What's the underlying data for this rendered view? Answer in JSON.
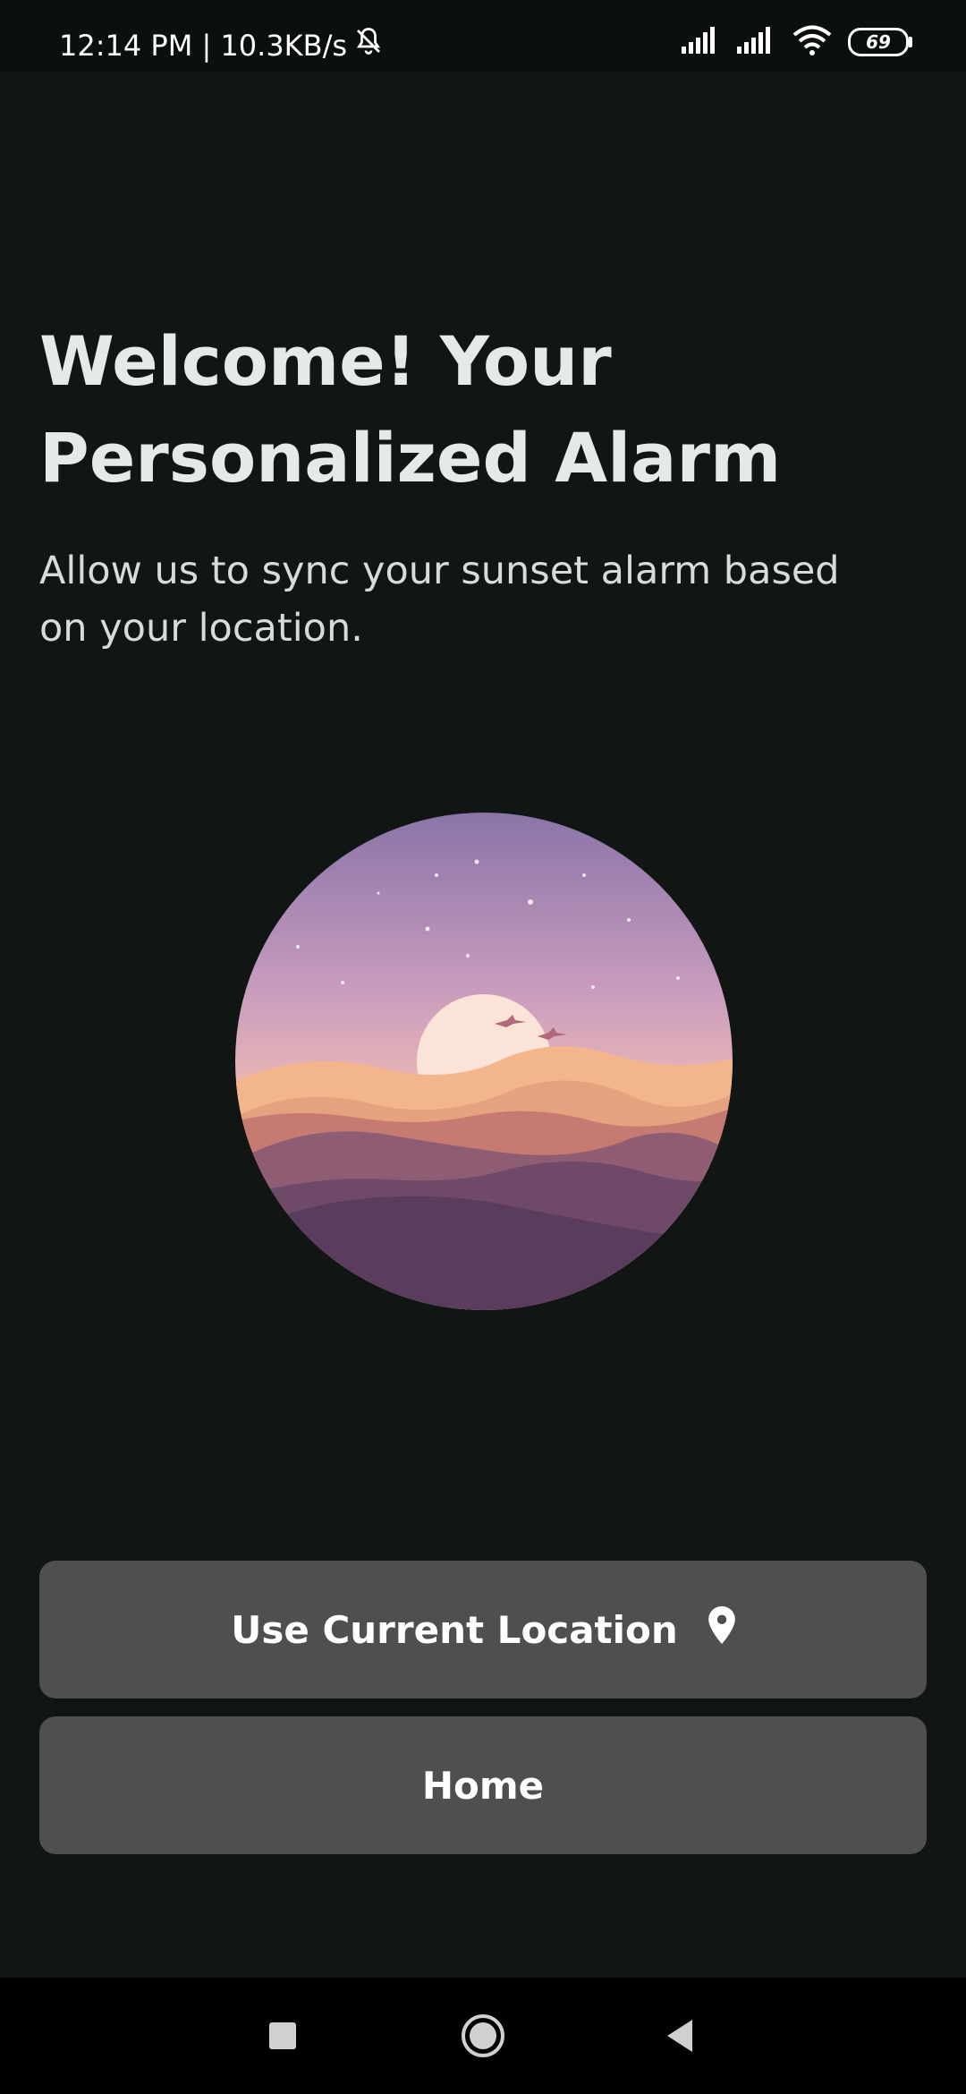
{
  "status_bar": {
    "time_speed": "12:14 PM | 10.3KB/s",
    "battery": "69",
    "icons": [
      "bell-off-icon",
      "signal-icon",
      "signal-icon",
      "wifi-icon",
      "battery-icon"
    ]
  },
  "main": {
    "title_line1": "Welcome! Your",
    "title_line2": "Personalized Alarm",
    "subtitle": "Allow us to sync your sunset alarm based on your location.",
    "illustration": "sunset-illustration"
  },
  "buttons": {
    "use_location_label": "Use Current Location",
    "use_location_icon": "location-pin-icon",
    "home_label": "Home"
  },
  "nav_bar": {
    "icons": [
      "recents-icon",
      "home-icon",
      "back-icon"
    ]
  },
  "colors": {
    "background": "#111615",
    "button": "#4f4f4f",
    "title_text": "#e5e9e7"
  }
}
